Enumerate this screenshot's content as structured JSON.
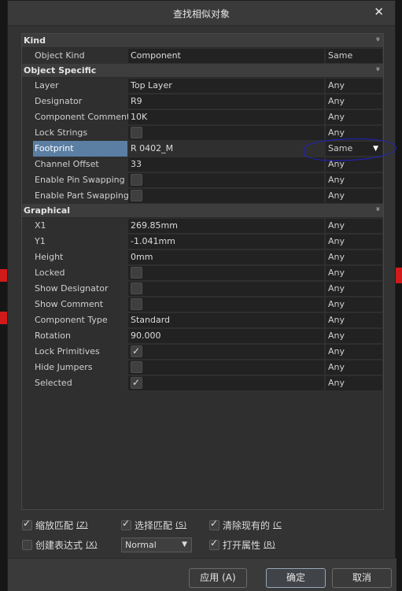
{
  "dialog": {
    "title": "查找相似对象"
  },
  "sections": [
    {
      "label": "Kind",
      "rows": [
        {
          "name": "Object Kind",
          "value": "Component",
          "match": "Same"
        }
      ]
    },
    {
      "label": "Object Specific",
      "rows": [
        {
          "name": "Layer",
          "value": "Top Layer",
          "match": "Any"
        },
        {
          "name": "Designator",
          "value": "R9",
          "match": "Any"
        },
        {
          "name": "Component Comment",
          "value": "10K",
          "match": "Any"
        },
        {
          "name": "Lock Strings",
          "value": "",
          "checkbox": true,
          "checked": false,
          "match": "Any"
        },
        {
          "name": "Footprint",
          "value": "R 0402_M",
          "match": "Same",
          "highlighted": true
        },
        {
          "name": "Channel Offset",
          "value": "33",
          "match": "Any"
        },
        {
          "name": "Enable Pin Swapping",
          "value": "",
          "checkbox": true,
          "checked": false,
          "match": "Any"
        },
        {
          "name": "Enable Part Swapping",
          "value": "",
          "checkbox": true,
          "checked": false,
          "match": "Any"
        }
      ]
    },
    {
      "label": "Graphical",
      "rows": [
        {
          "name": "X1",
          "value": "269.85mm",
          "match": "Any"
        },
        {
          "name": "Y1",
          "value": "-1.041mm",
          "match": "Any"
        },
        {
          "name": "Height",
          "value": "0mm",
          "match": "Any"
        },
        {
          "name": "Locked",
          "value": "",
          "checkbox": true,
          "checked": false,
          "match": "Any"
        },
        {
          "name": "Show Designator",
          "value": "",
          "checkbox": true,
          "checked": false,
          "match": "Any"
        },
        {
          "name": "Show Comment",
          "value": "",
          "checkbox": true,
          "checked": false,
          "match": "Any"
        },
        {
          "name": "Component Type",
          "value": "Standard",
          "match": "Any"
        },
        {
          "name": "Rotation",
          "value": "90.000",
          "match": "Any"
        },
        {
          "name": "Lock Primitives",
          "value": "",
          "checkbox": true,
          "checked": true,
          "match": "Any"
        },
        {
          "name": "Hide Jumpers",
          "value": "",
          "checkbox": true,
          "checked": false,
          "match": "Any"
        },
        {
          "name": "Selected",
          "value": "",
          "checkbox": true,
          "checked": true,
          "match": "Any"
        }
      ]
    }
  ],
  "options": {
    "zoom_matching": {
      "label": "缩放匹配",
      "shortcut": "(Z)",
      "checked": true
    },
    "select_matching": {
      "label": "选择匹配",
      "shortcut": "(S)",
      "checked": true
    },
    "clear_existing": {
      "label": "清除现有的",
      "shortcut": "(C",
      "checked": true
    },
    "create_expression": {
      "label": "创建表达式",
      "shortcut": "(X)",
      "checked": false
    },
    "mask_mode": {
      "value": "Normal"
    },
    "open_properties": {
      "label": "打开属性",
      "shortcut": "(R)",
      "checked": true
    }
  },
  "buttons": {
    "apply": "应用 (A)",
    "ok": "确定",
    "cancel": "取消"
  },
  "colors": {
    "highlight": "#5b7ea3",
    "ink_annotation": "#2020d0",
    "pcb_red": "#d11a1a"
  }
}
